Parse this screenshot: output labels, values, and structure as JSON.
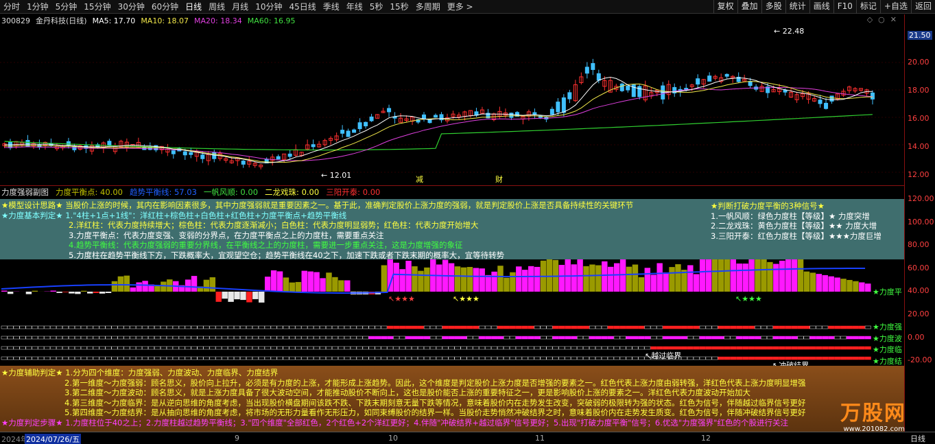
{
  "toolbar": {
    "periods": [
      "分时",
      "1分钟",
      "5分钟",
      "15分钟",
      "30分钟",
      "60分钟",
      "日线",
      "周线",
      "月线",
      "10分钟",
      "45日线",
      "季线",
      "年线",
      "5秒",
      "15秒",
      "多周期",
      "更多 >"
    ],
    "active_period": "日线",
    "tools": [
      "复权",
      "叠加",
      "多股",
      "统计",
      "画线",
      "F10",
      "标记",
      "+自选",
      "返回"
    ]
  },
  "main_chart": {
    "stock_code": "300829",
    "stock_name": "金丹科技(日线)",
    "ma5": "MA5: 17.70",
    "ma10": "MA10: 18.07",
    "ma20": "MA20: 18.34",
    "ma60": "MA60: 16.95",
    "high_marker": "22.48",
    "low_marker": "12.01",
    "event_tags": [
      "减",
      "财"
    ],
    "price_axis": [
      "20.00",
      "18.00",
      "16.00",
      "14.00",
      "12.00"
    ],
    "current_price": "21.50"
  },
  "indicator": {
    "name": "力度强弱副图",
    "fields": [
      {
        "label": "力度平衡点: 40.00"
      },
      {
        "label": "趋势平衡线: 57.03"
      },
      {
        "label": "一帆风顺: 0.00"
      },
      {
        "label": "二龙戏珠: 0.00"
      },
      {
        "label": "三阳开泰: 0.00"
      }
    ],
    "axis": [
      "120.00",
      "100.00",
      "80.00",
      "60.00",
      "40.00",
      "20.00",
      "0.00",
      "-20.00"
    ],
    "side_labels": [
      "力度平",
      "力度强",
      "力度波",
      "力度临",
      "力度结"
    ],
    "boundary_labels": [
      "↖越过临界",
      "↖冲破结界"
    ],
    "star_marks": [
      "↖★★★",
      "↖★★★",
      "↖★★★"
    ]
  },
  "panel_top": {
    "lines": [
      "★模型设计思路★ 当股价上涨的时候，其内在影响因素很多，其中力度强弱就是重要因素之一。基于此，准确判定股价上涨力度的强弱，就是判定股价上涨是否具备持续性的关键环节",
      "★力度基本判定★ 1.\"4柱+1点+1线\"：洋红柱+棕色柱+白色柱+红色柱+力度平衡点+趋势平衡线",
      "2.洋红柱：代表力度持续增大；棕色柱：代表力度逐渐减小；白色柱：代表力度明显弱势；红色柱：代表力度开始增大",
      "3.力度平衡点：代表力度变强、变弱的分界点，在力度平衡点之上的力度柱，需要重点关注",
      "4.趋势平衡线：代表力度强弱的重要分界线，在平衡线之上的力度柱，需要进一步重点关注，这是力度增强的象征",
      "5.力度柱在趋势平衡线下方，下跌概率大，宜观望空仓；趋势平衡线在40之下，加速下跌或者下跌末期的概率大，宜等待转势"
    ],
    "signals": [
      "★判断打破力度平衡的3种信号★",
      "1.一帆风顺：绿色力度柱【等级】★    力度突增",
      "2.二龙戏珠：黄色力度柱【等级】★★  力度大增",
      "3.三阳开泰：红色力度柱【等级】★★★力度巨增"
    ]
  },
  "panel_bottom": {
    "lines": [
      "★力度辅助判定★ 1.分为四个维度：力度强弱、力度波动、力度临界、力度结界",
      "2.第一维度～力度强弱：顾名思义，股价向上拉升，必须是有力度的上涨，才能形成上涨趋势。因此，这个维度是判定股价上涨力度是否增强的要素之一。红色代表上涨力度由弱转强，洋红色代表上涨力度明显增强",
      "3.第二维度～力度波动：顾名思义，就是上涨力度具备了很大波动空间，才能推动股价不断向上，这也是股价能否上涨的重要特征之一，更是影响股价上涨的要素之一。洋红色代表力度波动开始加大",
      "4.第三维度～力度临界：是从逆向思维的角度考虑，当出现股价横盘期间该跌不跌、下跌末期刻意无量下跌等情况，意味着股价内在走势发生改变，突破弱的极限转为强的状态。红色为信号，伴随越过临界信号更好",
      "5.第四维度～力度结界：是从抽向思维的角度考虑，将市场的无形力量看作无形压力，如同束缚股价的结界一样。当股价走势悄然冲破结界之时，意味着股价内在走势发生质变。红色为信号，伴随冲破结界信号更好",
      "★力度判定步骤★ 1.力度柱位于40之上；2.力度柱越过趋势平衡线；3.\"四个维度\"全部红色，2个红色+2个洋红更好；4.伴随\"冲破结界+越过临界\"信号更好；5.出现\"打破力度平衡\"信号；6.优选\"力度强界\"红色的个股进行关注"
    ]
  },
  "bottom_bar": {
    "dates": [
      "2024年",
      "2024/07/26/五",
      "9",
      "10",
      "11",
      "12"
    ],
    "period": "日线"
  },
  "watermark": {
    "main": "万股网",
    "sub": "www.201082.com"
  },
  "colors": {
    "up": "#ff3030",
    "down": "#40c0ff",
    "magenta": "#ff18ff",
    "olive": "#9a9a00",
    "trend": "#1840ff",
    "ma5": "#ffffff",
    "ma10": "#f2e84a",
    "ma20": "#e040e0",
    "ma60": "#30d030"
  },
  "icons": [
    "diamond-icon",
    "circle-icon",
    "close-icon"
  ]
}
